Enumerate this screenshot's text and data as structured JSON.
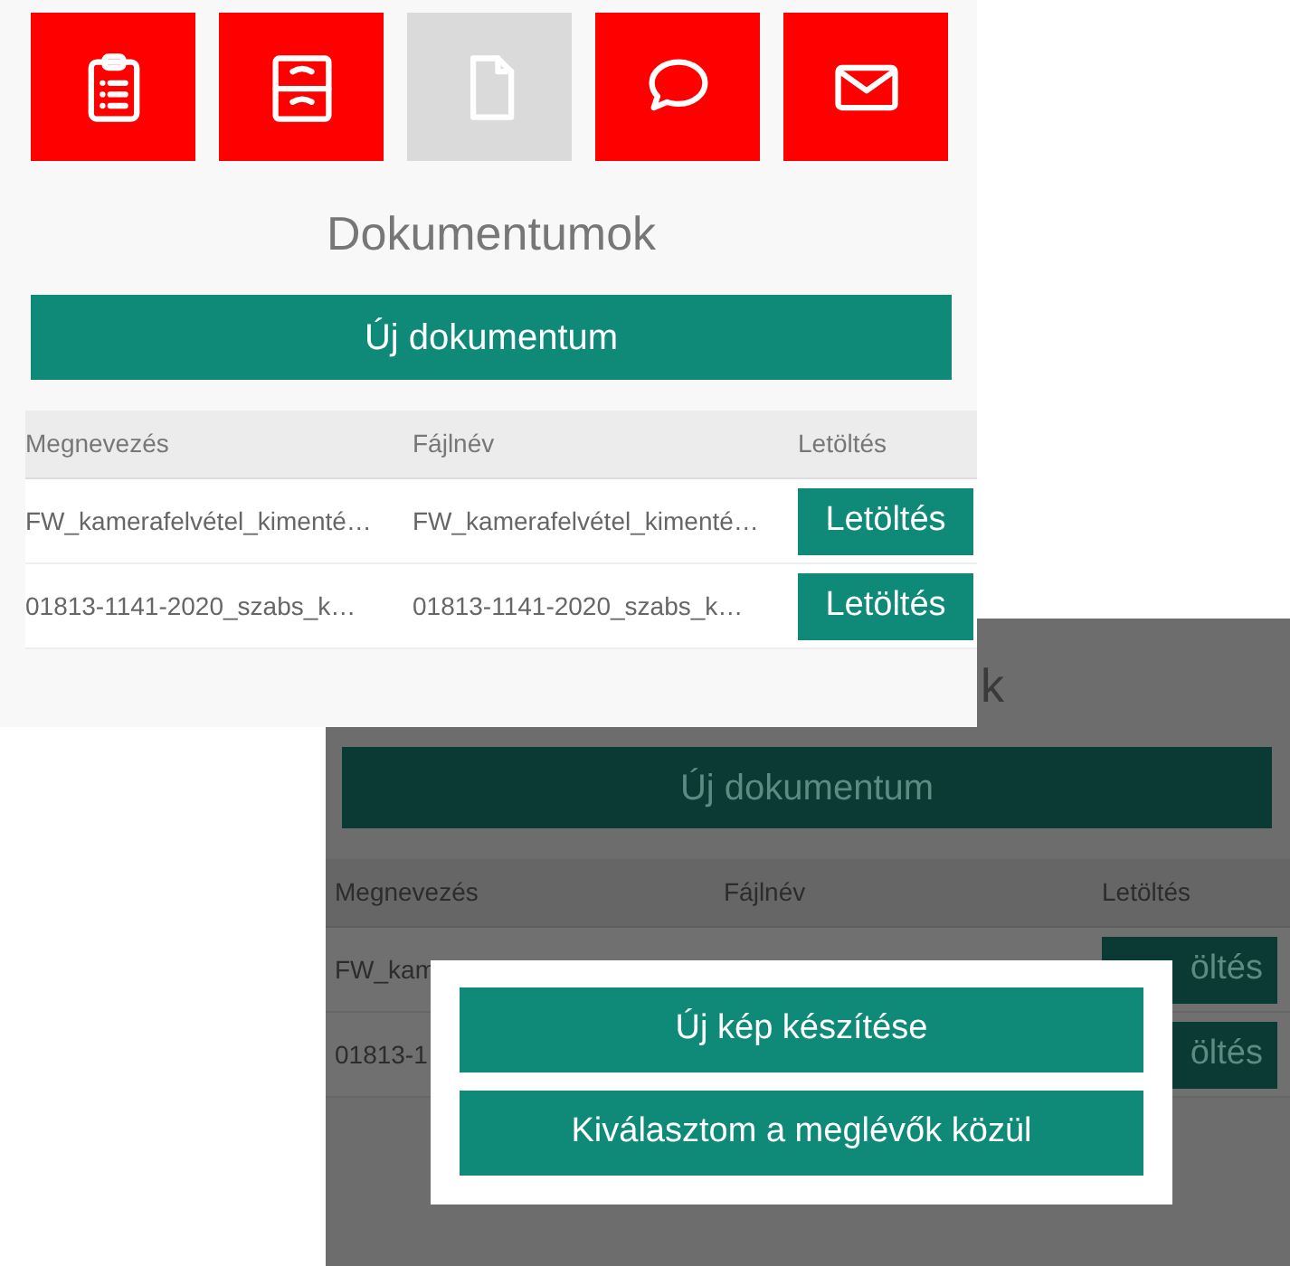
{
  "main_screen": {
    "tabs": [
      {
        "kind": "clipboard",
        "selected": false
      },
      {
        "kind": "cabinet",
        "selected": false
      },
      {
        "kind": "document",
        "selected": true
      },
      {
        "kind": "chat",
        "selected": false
      },
      {
        "kind": "mail",
        "selected": false
      }
    ],
    "title": "Dokumentumok",
    "new_button": "Új dokumentum",
    "table": {
      "columns": [
        "Megnevezés",
        "Fájlnév",
        "Letöltés"
      ],
      "rows": [
        {
          "name": "FW_kamerafelvétel_kimenté…",
          "file": "FW_kamerafelvétel_kimenté…",
          "action": "Letöltés"
        },
        {
          "name": "01813-1141-2020_szabs_k…",
          "file": "01813-1141-2020_szabs_k…",
          "action": "Letöltés"
        }
      ]
    }
  },
  "dialog_screen": {
    "dimmed": true,
    "title_fragment": "k",
    "new_button": "Új dokumentum",
    "table": {
      "columns": [
        "Megnevezés",
        "Fájlnév",
        "Letöltés"
      ],
      "rows": [
        {
          "name": "FW_kam",
          "action": "öltés"
        },
        {
          "name": "01813-1",
          "action": "öltés"
        }
      ]
    },
    "dialog": {
      "buttons": [
        "Új kép készítése",
        "Kiválasztom a meglévők közül"
      ]
    }
  }
}
